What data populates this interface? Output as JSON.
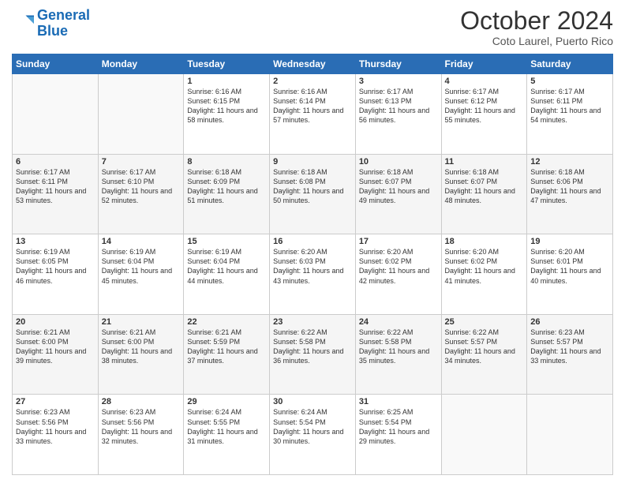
{
  "logo": {
    "line1": "General",
    "line2": "Blue"
  },
  "title": "October 2024",
  "location": "Coto Laurel, Puerto Rico",
  "days_of_week": [
    "Sunday",
    "Monday",
    "Tuesday",
    "Wednesday",
    "Thursday",
    "Friday",
    "Saturday"
  ],
  "weeks": [
    [
      {
        "day": "",
        "info": ""
      },
      {
        "day": "",
        "info": ""
      },
      {
        "day": "1",
        "info": "Sunrise: 6:16 AM\nSunset: 6:15 PM\nDaylight: 11 hours and 58 minutes."
      },
      {
        "day": "2",
        "info": "Sunrise: 6:16 AM\nSunset: 6:14 PM\nDaylight: 11 hours and 57 minutes."
      },
      {
        "day": "3",
        "info": "Sunrise: 6:17 AM\nSunset: 6:13 PM\nDaylight: 11 hours and 56 minutes."
      },
      {
        "day": "4",
        "info": "Sunrise: 6:17 AM\nSunset: 6:12 PM\nDaylight: 11 hours and 55 minutes."
      },
      {
        "day": "5",
        "info": "Sunrise: 6:17 AM\nSunset: 6:11 PM\nDaylight: 11 hours and 54 minutes."
      }
    ],
    [
      {
        "day": "6",
        "info": "Sunrise: 6:17 AM\nSunset: 6:11 PM\nDaylight: 11 hours and 53 minutes."
      },
      {
        "day": "7",
        "info": "Sunrise: 6:17 AM\nSunset: 6:10 PM\nDaylight: 11 hours and 52 minutes."
      },
      {
        "day": "8",
        "info": "Sunrise: 6:18 AM\nSunset: 6:09 PM\nDaylight: 11 hours and 51 minutes."
      },
      {
        "day": "9",
        "info": "Sunrise: 6:18 AM\nSunset: 6:08 PM\nDaylight: 11 hours and 50 minutes."
      },
      {
        "day": "10",
        "info": "Sunrise: 6:18 AM\nSunset: 6:07 PM\nDaylight: 11 hours and 49 minutes."
      },
      {
        "day": "11",
        "info": "Sunrise: 6:18 AM\nSunset: 6:07 PM\nDaylight: 11 hours and 48 minutes."
      },
      {
        "day": "12",
        "info": "Sunrise: 6:18 AM\nSunset: 6:06 PM\nDaylight: 11 hours and 47 minutes."
      }
    ],
    [
      {
        "day": "13",
        "info": "Sunrise: 6:19 AM\nSunset: 6:05 PM\nDaylight: 11 hours and 46 minutes."
      },
      {
        "day": "14",
        "info": "Sunrise: 6:19 AM\nSunset: 6:04 PM\nDaylight: 11 hours and 45 minutes."
      },
      {
        "day": "15",
        "info": "Sunrise: 6:19 AM\nSunset: 6:04 PM\nDaylight: 11 hours and 44 minutes."
      },
      {
        "day": "16",
        "info": "Sunrise: 6:20 AM\nSunset: 6:03 PM\nDaylight: 11 hours and 43 minutes."
      },
      {
        "day": "17",
        "info": "Sunrise: 6:20 AM\nSunset: 6:02 PM\nDaylight: 11 hours and 42 minutes."
      },
      {
        "day": "18",
        "info": "Sunrise: 6:20 AM\nSunset: 6:02 PM\nDaylight: 11 hours and 41 minutes."
      },
      {
        "day": "19",
        "info": "Sunrise: 6:20 AM\nSunset: 6:01 PM\nDaylight: 11 hours and 40 minutes."
      }
    ],
    [
      {
        "day": "20",
        "info": "Sunrise: 6:21 AM\nSunset: 6:00 PM\nDaylight: 11 hours and 39 minutes."
      },
      {
        "day": "21",
        "info": "Sunrise: 6:21 AM\nSunset: 6:00 PM\nDaylight: 11 hours and 38 minutes."
      },
      {
        "day": "22",
        "info": "Sunrise: 6:21 AM\nSunset: 5:59 PM\nDaylight: 11 hours and 37 minutes."
      },
      {
        "day": "23",
        "info": "Sunrise: 6:22 AM\nSunset: 5:58 PM\nDaylight: 11 hours and 36 minutes."
      },
      {
        "day": "24",
        "info": "Sunrise: 6:22 AM\nSunset: 5:58 PM\nDaylight: 11 hours and 35 minutes."
      },
      {
        "day": "25",
        "info": "Sunrise: 6:22 AM\nSunset: 5:57 PM\nDaylight: 11 hours and 34 minutes."
      },
      {
        "day": "26",
        "info": "Sunrise: 6:23 AM\nSunset: 5:57 PM\nDaylight: 11 hours and 33 minutes."
      }
    ],
    [
      {
        "day": "27",
        "info": "Sunrise: 6:23 AM\nSunset: 5:56 PM\nDaylight: 11 hours and 33 minutes."
      },
      {
        "day": "28",
        "info": "Sunrise: 6:23 AM\nSunset: 5:56 PM\nDaylight: 11 hours and 32 minutes."
      },
      {
        "day": "29",
        "info": "Sunrise: 6:24 AM\nSunset: 5:55 PM\nDaylight: 11 hours and 31 minutes."
      },
      {
        "day": "30",
        "info": "Sunrise: 6:24 AM\nSunset: 5:54 PM\nDaylight: 11 hours and 30 minutes."
      },
      {
        "day": "31",
        "info": "Sunrise: 6:25 AM\nSunset: 5:54 PM\nDaylight: 11 hours and 29 minutes."
      },
      {
        "day": "",
        "info": ""
      },
      {
        "day": "",
        "info": ""
      }
    ]
  ]
}
